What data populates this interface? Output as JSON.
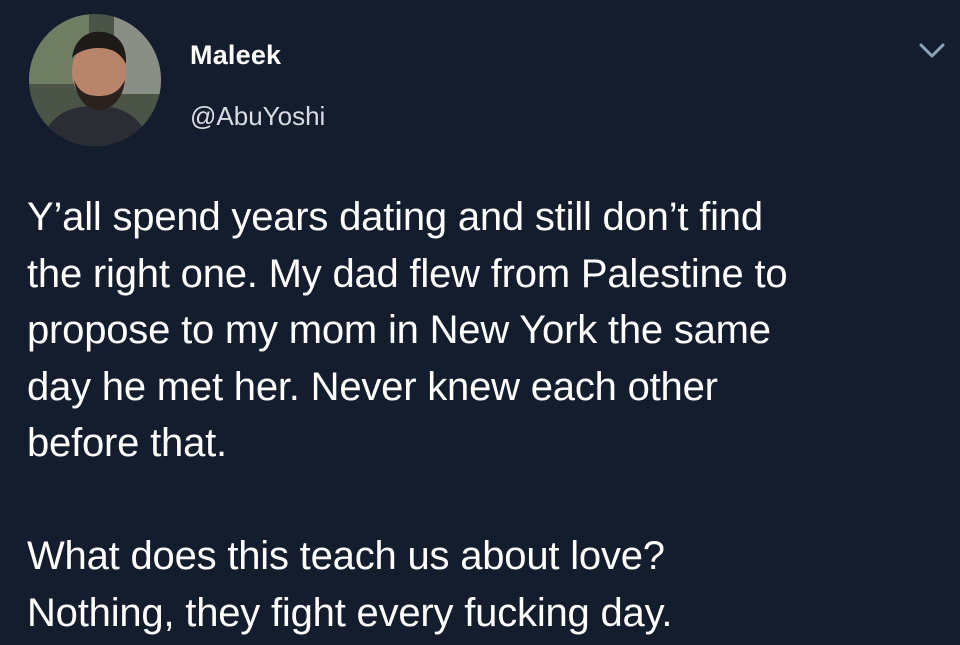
{
  "author": {
    "display_name": "Maleek",
    "handle": "@AbuYoshi"
  },
  "icons": {
    "menu": "chevron-down-icon",
    "avatar": "profile-photo"
  },
  "tweet": {
    "text": "Y’all spend years dating and still don’t find\nthe right one. My dad flew from Palestine to\npropose to my mom in New York the same\nday he met her. Never knew each other\nbefore that.\n\nWhat does this teach us about love?\nNothing, they fight every fucking day."
  },
  "colors": {
    "background": "#141d2e",
    "text": "#ffffff",
    "accent": "#1da1f2"
  }
}
